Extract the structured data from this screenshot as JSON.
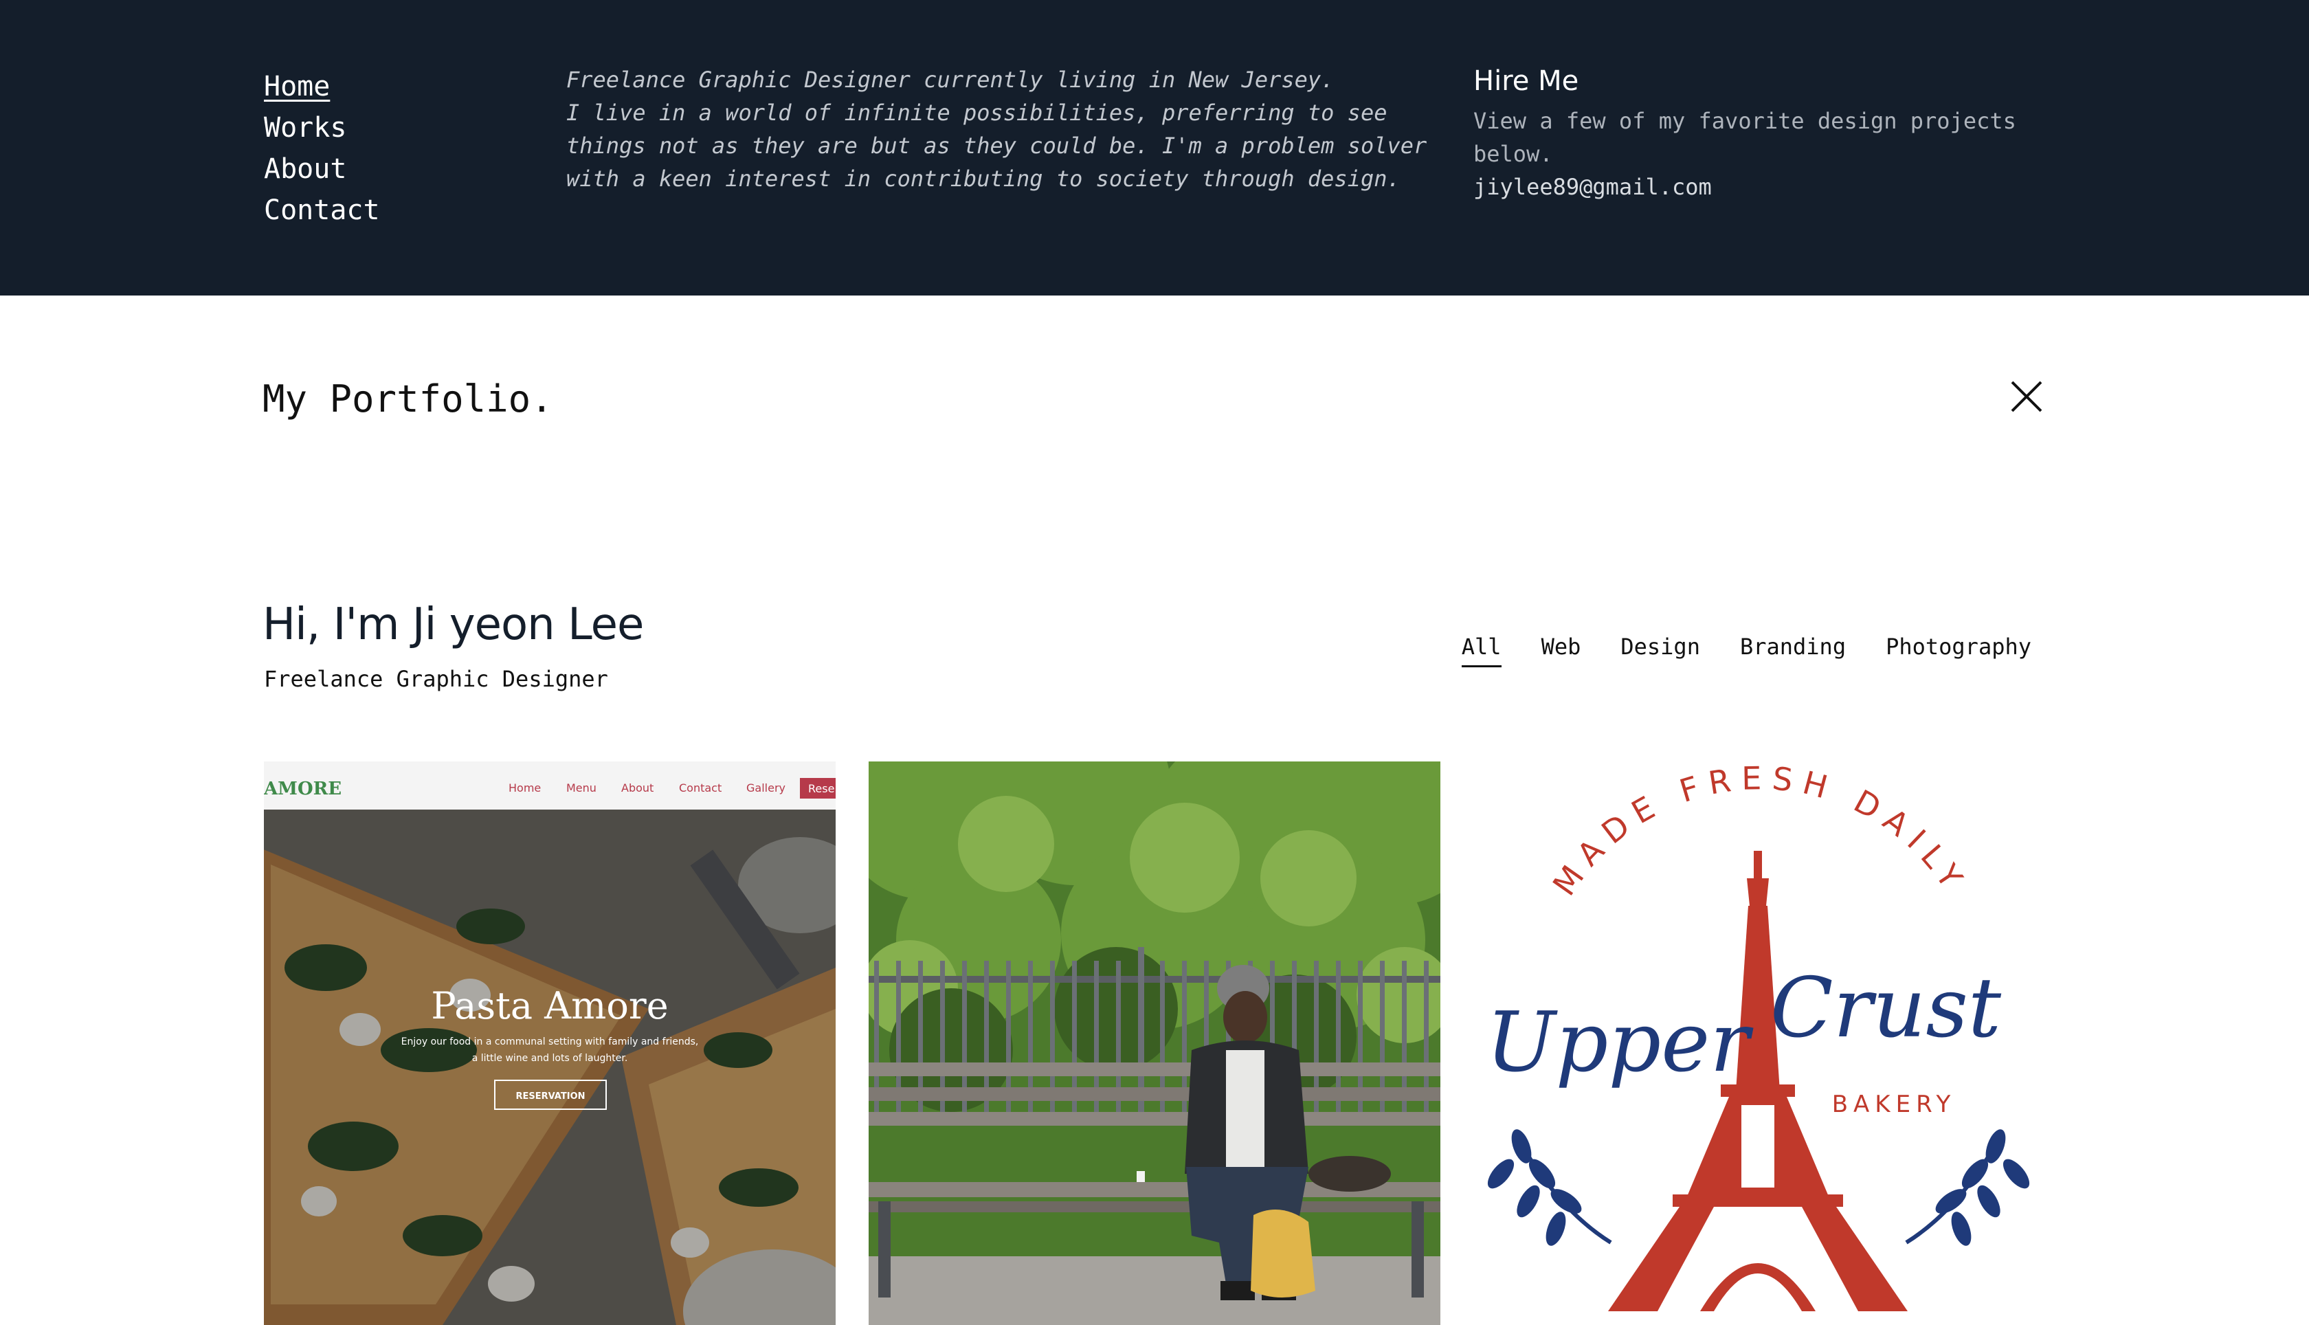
{
  "nav": {
    "items": [
      "Home",
      "Works",
      "About",
      "Contact"
    ]
  },
  "bio": {
    "text": "Freelance Graphic Designer currently living in New Jersey.\nI live in a world of infinite possibilities, preferring to see things not as they are but as they could be. I'm a problem solver with a keen interest in contributing to society through design."
  },
  "hire": {
    "title": "Hire Me",
    "text": "View a few of my favorite design projects below.",
    "email": "jiylee89@gmail.com"
  },
  "portfolio": {
    "title": "My Portfolio."
  },
  "intro": {
    "greeting": "Hi, I'm Ji yeon Lee",
    "role": "Freelance Graphic Designer"
  },
  "filters": [
    "All",
    "Web",
    "Design",
    "Branding",
    "Photography"
  ],
  "tiles": {
    "web": {
      "logo": "AMORE",
      "menu": [
        "Home",
        "Menu",
        "About",
        "Contact",
        "Gallery"
      ],
      "cta": "Rese",
      "hero_title": "Pasta Amore",
      "hero_line1": "Enjoy our food in a communal setting with family and friends,",
      "hero_line2": "a little wine and lots of laughter.",
      "hero_button": "RESERVATION"
    },
    "bakery": {
      "arc_text": "MADE FRESH DAILY",
      "script1": "Upper",
      "script2": "Crust",
      "sub": "BAKERY"
    }
  },
  "colors": {
    "top_panel": "#141e2b",
    "bakery_red": "#c0392b",
    "bakery_navy": "#1f3a7a",
    "web_accent": "#b63a4a"
  }
}
